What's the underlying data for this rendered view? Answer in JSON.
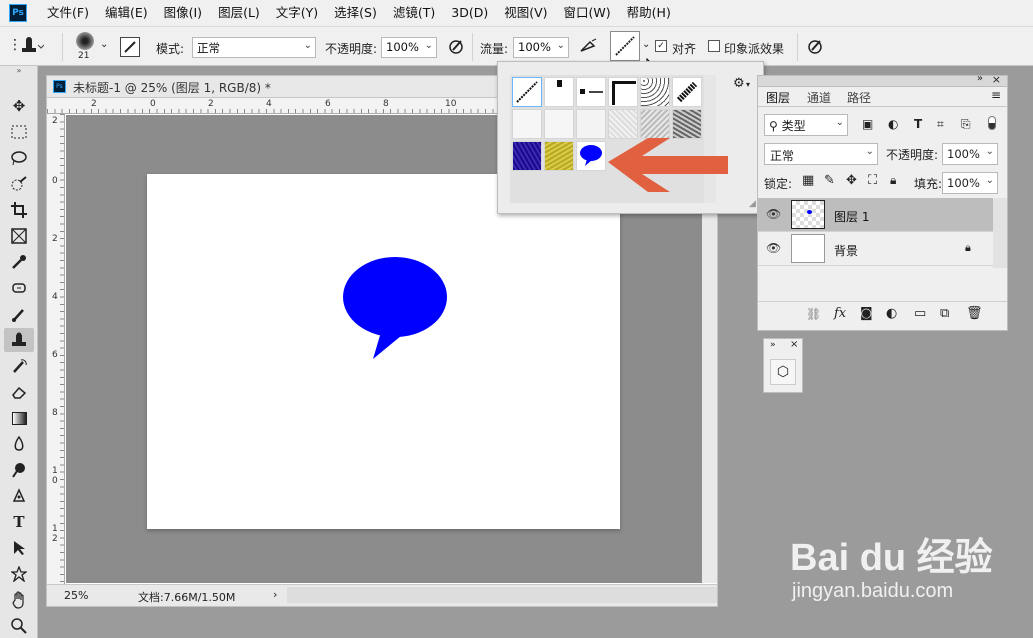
{
  "app": {
    "logo": "Ps"
  },
  "menu": [
    "文件(F)",
    "编辑(E)",
    "图像(I)",
    "图层(L)",
    "文字(Y)",
    "选择(S)",
    "滤镜(T)",
    "3D(D)",
    "视图(V)",
    "窗口(W)",
    "帮助(H)"
  ],
  "options": {
    "brush_size": "21",
    "mode_label": "模式:",
    "mode_value": "正常",
    "opacity_label": "不透明度:",
    "opacity_value": "100%",
    "flow_label": "流量:",
    "flow_value": "100%",
    "align_label": "对齐",
    "align_checked": true,
    "impressionist_label": "印象派效果",
    "impressionist_checked": false
  },
  "document": {
    "tab_title": "未标题-1 @ 25% (图层 1, RGB/8) *",
    "ruler_h": [
      "2",
      "0",
      "2",
      "4",
      "6",
      "8",
      "10"
    ],
    "ruler_v": [
      "2",
      "0",
      "2",
      "4",
      "6",
      "8",
      "1 0",
      "1 2"
    ],
    "zoom": "25%",
    "doc_info": "文档:7.66M/1.50M",
    "shape_color": "#0000ff"
  },
  "brush_picker": {
    "selected_index": 0,
    "presets": [
      "hard-diagonal",
      "spatter-1",
      "spatter-2",
      "square-corner",
      "dots-texture",
      "diagonal-dark",
      "soft-light-1",
      "soft-light-2",
      "soft-light-3",
      "texture-grey-1",
      "texture-grey-2",
      "texture-grey-3",
      "blue-texture",
      "yellow-texture",
      "speech-bubble"
    ],
    "arrow_color": "#e06040"
  },
  "layers_panel": {
    "tabs": [
      "图层",
      "通道",
      "路径"
    ],
    "active_tab": "图层",
    "filter_label": "类型",
    "blend_mode": "正常",
    "opacity_label": "不透明度:",
    "opacity_value": "100%",
    "lock_label": "锁定:",
    "fill_label": "填充:",
    "fill_value": "100%",
    "layers": [
      {
        "name": "图层 1",
        "selected": true
      },
      {
        "name": "背景",
        "selected": false,
        "locked": true
      }
    ]
  },
  "watermark": {
    "brand": "Bai du 经验",
    "url": "jingyan.baidu.com"
  }
}
